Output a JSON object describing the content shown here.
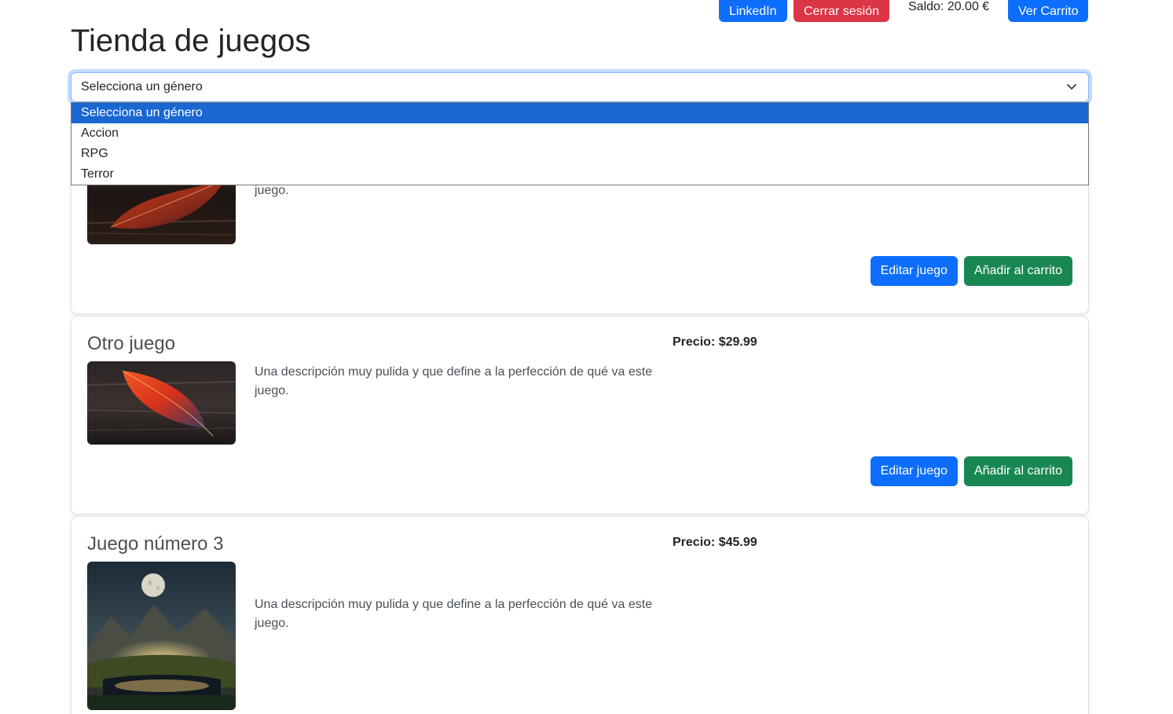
{
  "nav": {
    "linkedin_label": "LinkedIn",
    "logout_label": "Cerrar sesión",
    "balance_text": "Saldo: 20.00 €",
    "cart_label": "Ver Carrito"
  },
  "page": {
    "title": "Tienda de juegos"
  },
  "genre_select": {
    "selected": "Selecciona un género",
    "options": [
      "Selecciona un género",
      "Accion",
      "RPG",
      "Terror"
    ]
  },
  "games": [
    {
      "title": "",
      "price": "",
      "description": "juego.",
      "image": "red-leaf-on-wood",
      "edit_label": "Editar juego",
      "add_label": "Añadir al carrito"
    },
    {
      "title": "Otro juego",
      "price": "Precio: $29.99",
      "description": "Una descripción muy pulida y que define a la perfección de qué va este juego.",
      "image": "red-leaf-on-wood",
      "edit_label": "Editar juego",
      "add_label": "Añadir al carrito"
    },
    {
      "title": "Juego número 3",
      "price": "Precio: $45.99",
      "description": "Una descripción muy pulida y que define a la perfección de qué va este juego.",
      "image": "moonlit-mountain-landscape",
      "edit_label": "",
      "add_label": ""
    }
  ],
  "colors": {
    "primary": "#0d6efd",
    "danger": "#dc3545",
    "success": "#198754",
    "dropdown_highlight": "#1a67d2"
  }
}
